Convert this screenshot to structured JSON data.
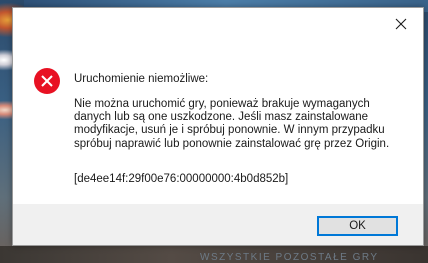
{
  "background": {
    "caption": "WSZYSTKIE POZOSTAŁE GRY"
  },
  "dialog": {
    "close_icon": "close-icon",
    "error_icon": "error-circle-icon",
    "heading": "Uruchomienie niemożliwe:",
    "message": "Nie można uruchomić gry, ponieważ brakuje wymaganych danych lub są one uszkodzone. Jeśli masz zainstalowane modyfikacje, usuń je i spróbuj ponownie. W innym przypadku spróbuj naprawić lub ponownie zainstalować grę przez Origin.",
    "error_code": "[de4ee14f:29f00e76:00000000:4b0d852b]",
    "ok_label": "OK"
  },
  "colors": {
    "accent": "#0078d7",
    "error_red": "#e81123",
    "footer_bg": "#f0f0f0"
  }
}
